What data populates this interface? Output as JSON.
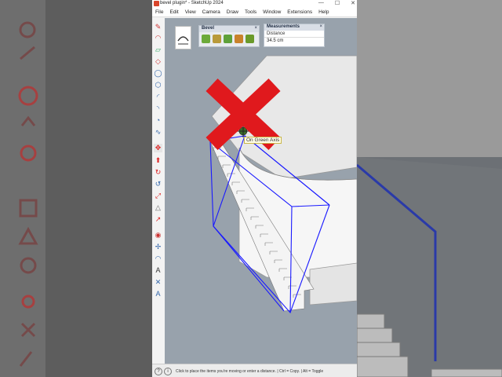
{
  "window": {
    "title": "bevel plugin* - SketchUp 2024",
    "controls": [
      "—",
      "☐",
      "✕"
    ]
  },
  "menu": [
    "File",
    "Edit",
    "View",
    "Camera",
    "Draw",
    "Tools",
    "Window",
    "Extensions",
    "Help"
  ],
  "bevel_panel": {
    "title": "Bevel",
    "close": "×"
  },
  "measurements": {
    "title": "Measurements",
    "close": "×",
    "label": "Distance",
    "value": "34.5 cm"
  },
  "inference_tooltip": "On Green Axis",
  "status": {
    "message": "Click to place the items you're moving or enter a distance. | Ctrl = Copy. | Alt = Toggle"
  },
  "colors": {
    "selection": "#1a1aff",
    "cross": "#e0191d",
    "viewport_bg": "#98a2ac"
  }
}
